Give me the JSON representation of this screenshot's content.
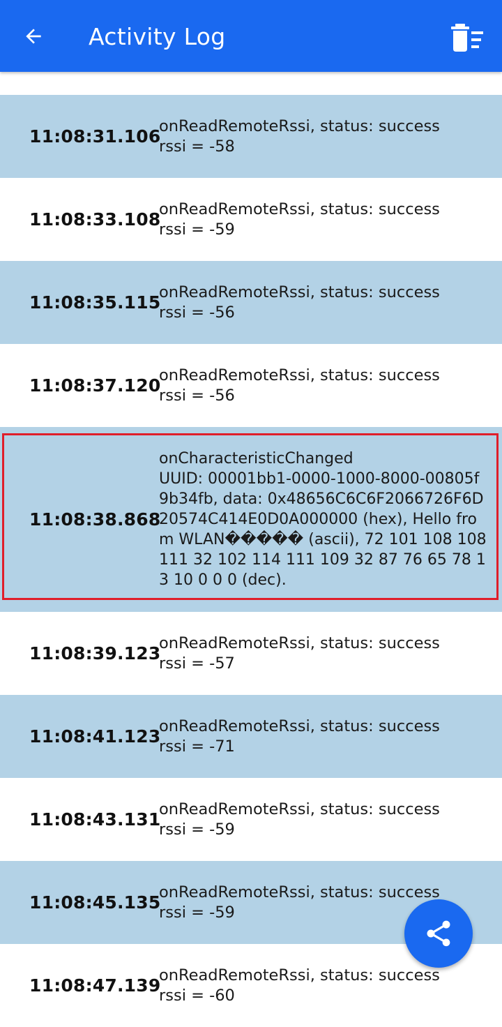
{
  "appbar": {
    "title": "Activity Log",
    "back_icon": "arrow-back-icon",
    "clear_icon": "delete-sweep-icon"
  },
  "colors": {
    "primary": "#1a69f0",
    "row_shaded": "#b3d2e6",
    "row_plain": "#ffffff",
    "highlight": "#e01e2a"
  },
  "entries": [
    {
      "time": "11:08:31.106",
      "message": "onReadRemoteRssi, status: success\nrssi = -58"
    },
    {
      "time": "11:08:33.108",
      "message": "onReadRemoteRssi, status: success\nrssi = -59"
    },
    {
      "time": "11:08:35.115",
      "message": "onReadRemoteRssi, status: success\nrssi = -56"
    },
    {
      "time": "11:08:37.120",
      "message": "onReadRemoteRssi, status: success\nrssi = -56"
    },
    {
      "time": "11:08:38.868",
      "message": "onCharacteristicChanged\nUUID: 00001bb1-0000-1000-8000-00805f9b34fb, data: 0x48656C6C6F2066726F6D20574C414E0D0A000000 (hex), Hello from WLAN����� (ascii), 72 101 108 108 111 32 102 114 111 109 32 87 76 65 78 13 10 0 0 0 (dec)."
    },
    {
      "time": "11:08:39.123",
      "message": "onReadRemoteRssi, status: success\nrssi = -57"
    },
    {
      "time": "11:08:41.123",
      "message": "onReadRemoteRssi, status: success\nrssi = -71"
    },
    {
      "time": "11:08:43.131",
      "message": "onReadRemoteRssi, status: success\nrssi = -59"
    },
    {
      "time": "11:08:45.135",
      "message": "onReadRemoteRssi, status: success\nrssi = -59"
    },
    {
      "time": "11:08:47.139",
      "message": "onReadRemoteRssi, status: success\nrssi = -60"
    }
  ],
  "fab": {
    "icon": "share-icon"
  }
}
